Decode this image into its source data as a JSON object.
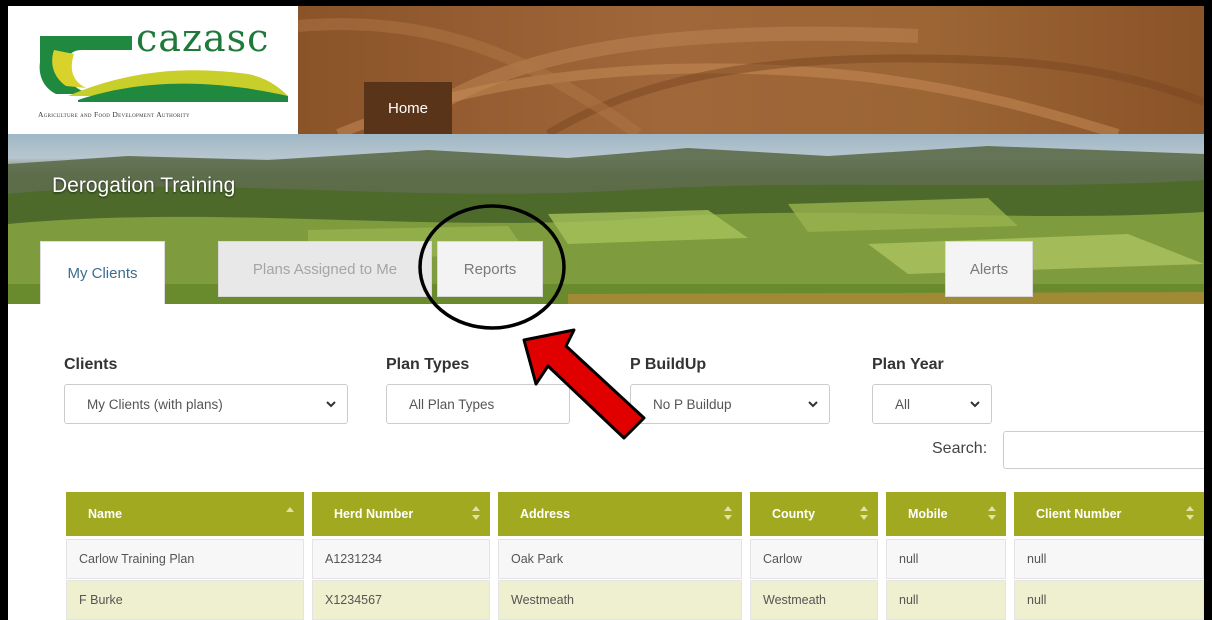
{
  "logo": {
    "wordmark": "cazasc",
    "subtitle": "Agriculture and Food Development Authority"
  },
  "nav": {
    "home": "Home"
  },
  "page_title": "Derogation Training",
  "tabs": [
    {
      "label": "My Clients"
    },
    {
      "label": "Plans Assigned to Me"
    },
    {
      "label": "Reports"
    },
    {
      "label": "Alerts"
    }
  ],
  "filters": {
    "clients": {
      "label": "Clients",
      "value": "My Clients (with plans)"
    },
    "plan_types": {
      "label": "Plan Types",
      "value": "All Plan Types"
    },
    "p_buildup": {
      "label": "P BuildUp",
      "value": "No P Buildup"
    },
    "plan_year": {
      "label": "Plan Year",
      "value": "All"
    }
  },
  "search": {
    "label": "Search:",
    "value": ""
  },
  "table": {
    "columns": [
      "Name",
      "Herd Number",
      "Address",
      "County",
      "Mobile",
      "Client Number"
    ],
    "rows": [
      [
        "Carlow Training Plan",
        "A1231234",
        "Oak Park",
        "Carlow",
        "null",
        "null"
      ],
      [
        "F Burke",
        "X1234567",
        "Westmeath",
        "Westmeath",
        "null",
        "null"
      ]
    ]
  },
  "colors": {
    "header_brown": "#8a5328",
    "home_tab": "#5a3419",
    "table_header": "#a1a920",
    "row_alt": "#eef0cf",
    "annotation_red": "#e00000"
  },
  "icons": {
    "select_caret": "chevron-down-icon",
    "sort": "sort-icon",
    "annotation": "red-arrow-icon"
  }
}
